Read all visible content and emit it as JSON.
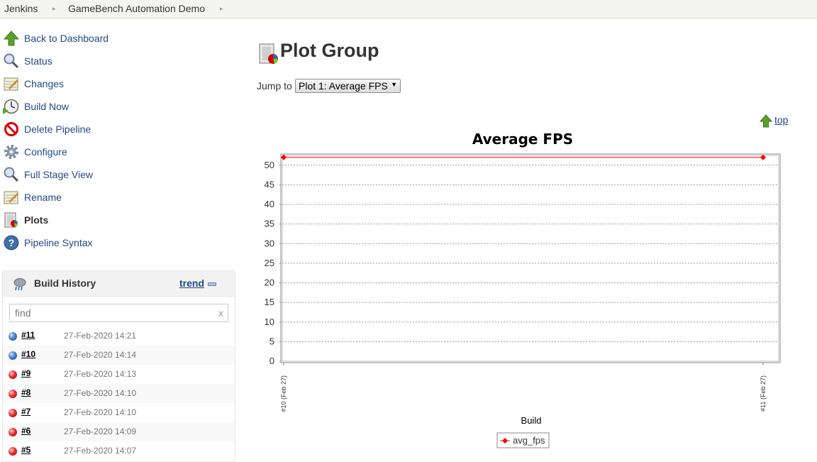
{
  "breadcrumbs": [
    "Jenkins",
    "GameBench Automation Demo"
  ],
  "tasks": [
    {
      "label": "Back to Dashboard",
      "icon": "up-arrow-icon"
    },
    {
      "label": "Status",
      "icon": "magnifier-icon"
    },
    {
      "label": "Changes",
      "icon": "notepad-icon"
    },
    {
      "label": "Build Now",
      "icon": "clock-icon"
    },
    {
      "label": "Delete Pipeline",
      "icon": "no-entry-icon"
    },
    {
      "label": "Configure",
      "icon": "gear-icon"
    },
    {
      "label": "Full Stage View",
      "icon": "magnifier-icon"
    },
    {
      "label": "Rename",
      "icon": "notepad-icon"
    },
    {
      "label": "Plots",
      "icon": "plot-icon"
    },
    {
      "label": "Pipeline Syntax",
      "icon": "help-icon"
    }
  ],
  "build_history": {
    "title": "Build History",
    "trend": "trend",
    "find_placeholder": "find",
    "find_clear": "x",
    "builds": [
      {
        "number": "#11",
        "date": "27-Feb-2020 14:21",
        "status": "blue"
      },
      {
        "number": "#10",
        "date": "27-Feb-2020 14:14",
        "status": "blue"
      },
      {
        "number": "#9",
        "date": "27-Feb-2020 14:13",
        "status": "red"
      },
      {
        "number": "#8",
        "date": "27-Feb-2020 14:10",
        "status": "red"
      },
      {
        "number": "#7",
        "date": "27-Feb-2020 14:10",
        "status": "red"
      },
      {
        "number": "#6",
        "date": "27-Feb-2020 14:09",
        "status": "red"
      },
      {
        "number": "#5",
        "date": "27-Feb-2020 14:07",
        "status": "red"
      }
    ]
  },
  "main": {
    "title": "Plot Group",
    "jump_label": "Jump to",
    "jump_selected": "Plot 1: Average FPS",
    "top_link": "top"
  },
  "colors": {
    "link": "#204a87",
    "series": "#ff0000"
  },
  "chart_data": {
    "type": "line",
    "title": "Average FPS",
    "xlabel": "Build",
    "ylabel": "",
    "categories": [
      "#10 (Feb 27)",
      "#11 (Feb 27)"
    ],
    "series": [
      {
        "name": "avg_fps",
        "values": [
          52,
          52
        ]
      }
    ],
    "y_ticks": [
      0,
      5,
      10,
      15,
      20,
      25,
      30,
      35,
      40,
      45,
      50
    ],
    "ylim": [
      0,
      52.5
    ],
    "grid": true,
    "legend": "bottom-center"
  }
}
